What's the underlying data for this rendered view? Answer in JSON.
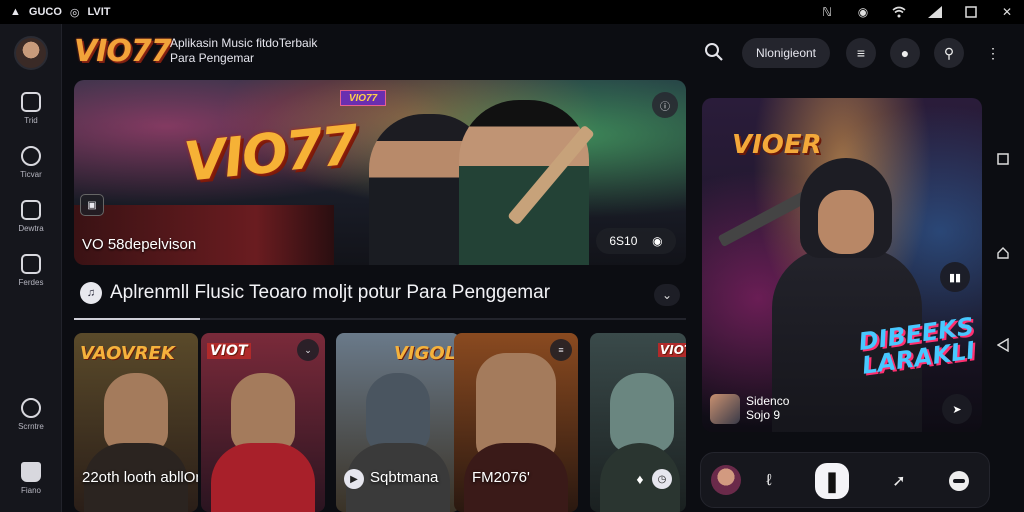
{
  "status_bar": {
    "left_items": [
      "▲",
      "GUCO",
      "◎",
      "LVIT"
    ],
    "right_icons": [
      "nfc-icon",
      "target-icon",
      "wifi-icon",
      "signal-icon",
      "battery-icon",
      "close-icon"
    ]
  },
  "rail": {
    "items": [
      {
        "label": "Trid",
        "icon": "home-square-icon"
      },
      {
        "label": "Ticvar",
        "icon": "tag-icon"
      },
      {
        "label": "Dewtra",
        "icon": "library-icon"
      },
      {
        "label": "Ferdes",
        "icon": "list-icon"
      },
      {
        "label": "Scrntre",
        "icon": "chat-icon"
      },
      {
        "label": "Fiano",
        "icon": "home-icon"
      }
    ]
  },
  "header": {
    "logo": "VIO77",
    "tagline_line1": "Aplikasin Music fitdoTerbaik",
    "tagline_line2": "Para Pengemar",
    "pill_label": "Nlonigieont"
  },
  "hero": {
    "logo": "VIO77",
    "tag": "VIO77",
    "caption": "VO 58depelvison",
    "pill_text": "6S10"
  },
  "section": {
    "title": "Aplrenmll Flusic Teoaro moljt potur Para Penggemar"
  },
  "cards": [
    {
      "title": "VAOVREK",
      "caption": "22oth looth abllOn",
      "bg_top": "#5a4a2a",
      "bg_bottom": "#2a1e18",
      "body": "#2b2420"
    },
    {
      "title": "VIOT",
      "caption": "",
      "bg_top": "#7a2a3a",
      "bg_bottom": "#2a1420",
      "body": "#a8202a"
    },
    {
      "title": "VIGOL",
      "caption": "Sqbtmana",
      "bg_top": "#6a7a8a",
      "bg_bottom": "#3a3226",
      "body": "#3a3a3a"
    },
    {
      "title": "",
      "caption": "FM2076'",
      "bg_top": "#8a4a20",
      "bg_bottom": "#2a1810",
      "body": "#3a1a18"
    },
    {
      "title": "VIOT",
      "caption": "",
      "bg_top": "#3a4a4a",
      "bg_bottom": "#1a2020",
      "body": "#2a3530"
    }
  ],
  "feature": {
    "logo": "VIOER",
    "graffiti_line1": "DIBEEKS",
    "graffiti_line2": "LARAKLI",
    "meta_line1": "Sidenco",
    "meta_line2": "Sojo 9"
  }
}
